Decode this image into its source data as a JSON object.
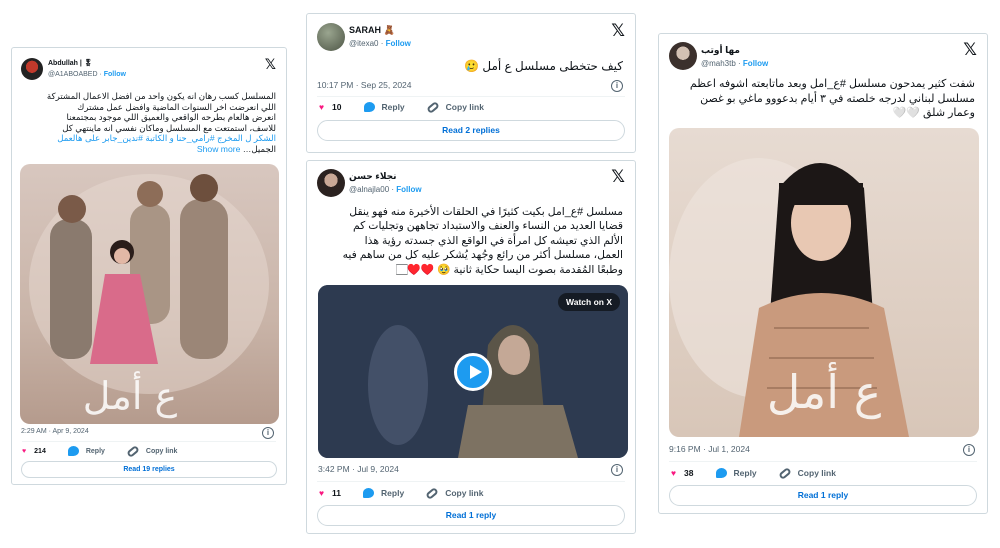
{
  "tweets": [
    {
      "name": "Abdullah | 🎖",
      "handle": "@A1ABOABED",
      "follow": "Follow",
      "text_lines": [
        "المسلسل كسب رهان انه يكون واحد من افضل الاعمال المشتركة",
        "اللي انعرضت اخر السنوات  الماضية وافضل عمل مشترك",
        "انعرض هالعام بطرحه  الواقعي والعميق اللي موجود بمجتمعنا",
        "للاسف، استمتعت مع المسلسل وماكان نفسي انه ماينتهي كل",
        "الشكر ل المخرج #رامي_حنا و الكاتبة #ندين_جابر على هالعمل",
        "الجميل…"
      ],
      "show_more": "Show more",
      "time": "2:29 AM · Apr 9, 2024",
      "likes": "214",
      "reply_label": "Reply",
      "copy_label": "Copy link",
      "replies_button": "Read 19 replies"
    },
    {
      "name": "SARAH 🧸",
      "handle": "@itexa0",
      "follow": "Follow",
      "text": "كيف حتخطى مسلسل ع أمل 🥲",
      "time": "10:17 PM · Sep 25, 2024",
      "likes": "10",
      "reply_label": "Reply",
      "copy_label": "Copy link",
      "replies_button": "Read 2 replies"
    },
    {
      "name": "نجلاء حسن",
      "handle": "@alnajla00",
      "follow": "Follow",
      "text_lines": [
        "مسلسل #ع_امل بكيت كثيرًا في الحلقات الأخيرة منه فهو ينقل",
        "قضايا العديد من النساء والعنف والاستبداد تجاههن وتجليات كم",
        "الألم الذي تعيشه كل امرأة في الواقع الذي جسدته رؤية هذا",
        "العمل، مسلسل أكثر من رائع وجُهد يُشكر عليه كل من ساهم فيه",
        "وطبعًا المُقدمة بصوت اليسا حكاية ثانية 🥹 ♥️♥️🏻"
      ],
      "watch_label": "Watch on X",
      "time": "3:42 PM · Jul 9, 2024",
      "likes": "11",
      "reply_label": "Reply",
      "copy_label": "Copy link",
      "replies_button": "Read 1 reply"
    },
    {
      "name": "مها أوتب",
      "handle": "@mah3tb",
      "follow": "Follow",
      "text_lines": [
        "شفت كثير يمدحون مسلسل #ع_امل وبعد ماتابعته اشوفه اعظم",
        "مسلسل لبناني لدرجه خلصته في ٣ أيام بدعووو ماغي بو غصن",
        "وعمار شلق 🤍🤍"
      ],
      "time": "9:16 PM · Jul 1, 2024",
      "likes": "38",
      "reply_label": "Reply",
      "copy_label": "Copy link",
      "replies_button": "Read 1 reply"
    }
  ],
  "x_logo": "𝕏",
  "colors": {
    "accent": "#1d9bf0",
    "heart": "#f91880",
    "link": "#006fd6",
    "border": "#cfd9de"
  }
}
